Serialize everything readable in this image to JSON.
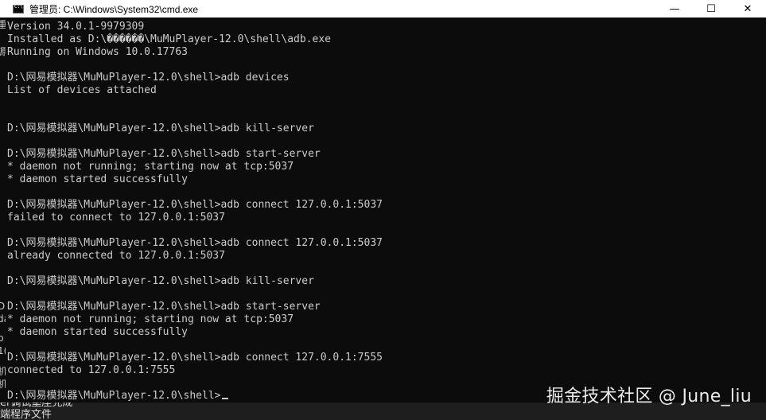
{
  "window": {
    "title": "管理员: C:\\Windows\\System32\\cmd.exe",
    "minimize_glyph": "—",
    "maximize_glyph": "☐",
    "close_glyph": "✕",
    "icon": "cmd-icon"
  },
  "console": {
    "lines": [
      "Version 34.0.1-9979309",
      "Installed as D:\\������\\MuMuPlayer-12.0\\shell\\adb.exe",
      "Running on Windows 10.0.17763",
      "",
      "D:\\网易模拟器\\MuMuPlayer-12.0\\shell>adb devices",
      "List of devices attached",
      "",
      "",
      "D:\\网易模拟器\\MuMuPlayer-12.0\\shell>adb kill-server",
      "",
      "D:\\网易模拟器\\MuMuPlayer-12.0\\shell>adb start-server",
      "* daemon not running; starting now at tcp:5037",
      "* daemon started successfully",
      "",
      "D:\\网易模拟器\\MuMuPlayer-12.0\\shell>adb connect 127.0.0.1:5037",
      "failed to connect to 127.0.0.1:5037",
      "",
      "D:\\网易模拟器\\MuMuPlayer-12.0\\shell>adb connect 127.0.0.1:5037",
      "already connected to 127.0.0.1:5037",
      "",
      "D:\\网易模拟器\\MuMuPlayer-12.0\\shell>adb kill-server",
      "",
      "D:\\网易模拟器\\MuMuPlayer-12.0\\shell>adb start-server",
      "* daemon not running; starting now at tcp:5037",
      "* daemon started successfully",
      "",
      "D:\\网易模拟器\\MuMuPlayer-12.0\\shell>adb connect 127.0.0.1:7555",
      "connected to 127.0.0.1:7555",
      "",
      "D:\\网易模拟器\\MuMuPlayer-12.0\\shell>"
    ]
  },
  "background_window": {
    "left_edge_glyphs": [
      "重",
      "源",
      "D",
      "da",
      "p",
      "1(",
      "机",
      "机"
    ],
    "bottom_lines": [
      "er调试壑座完成",
      "端程序文件"
    ]
  },
  "watermark": "掘金技术社区 @ June_liu",
  "colors": {
    "console_bg": "#0c0c0c",
    "console_fg": "#cccccc",
    "titlebar_bg": "#ffffff"
  }
}
